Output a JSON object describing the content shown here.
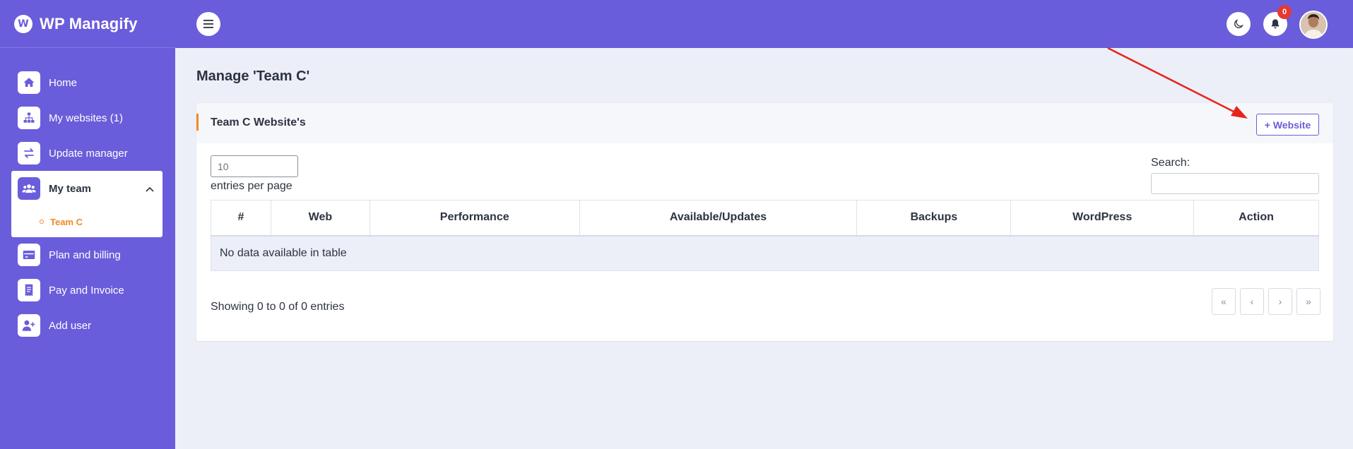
{
  "brand": {
    "name": "WP Managify",
    "logo_letter": "W"
  },
  "sidebar": {
    "items": [
      {
        "label": "Home",
        "icon": "home-icon"
      },
      {
        "label": "My websites (1)",
        "icon": "sitemap-icon"
      },
      {
        "label": "Update manager",
        "icon": "swap-icon"
      },
      {
        "label": "My team",
        "icon": "users-icon",
        "expanded": true,
        "children": [
          {
            "label": "Team C"
          }
        ]
      },
      {
        "label": "Plan and billing",
        "icon": "credit-card-icon"
      },
      {
        "label": "Pay and Invoice",
        "icon": "receipt-icon"
      },
      {
        "label": "Add user",
        "icon": "user-plus-icon"
      }
    ]
  },
  "header": {
    "notifications_count": "0"
  },
  "page": {
    "title": "Manage 'Team C'"
  },
  "card": {
    "title": "Team C Website's",
    "add_button_label": "+ Website",
    "length_placeholder": "10",
    "length_label": "entries per page",
    "search_label": "Search:",
    "columns": [
      "#",
      "Web",
      "Performance",
      "Available/Updates",
      "Backups",
      "WordPress",
      "Action"
    ],
    "empty_text": "No data available in table",
    "info": "Showing 0 to 0 of 0 entries",
    "pager": [
      "«",
      "‹",
      "›",
      "»"
    ]
  },
  "colors": {
    "primary": "#6a5ddb",
    "accent": "#f08a24",
    "annotation_arrow": "#e8231a",
    "badge": "#e53935"
  }
}
